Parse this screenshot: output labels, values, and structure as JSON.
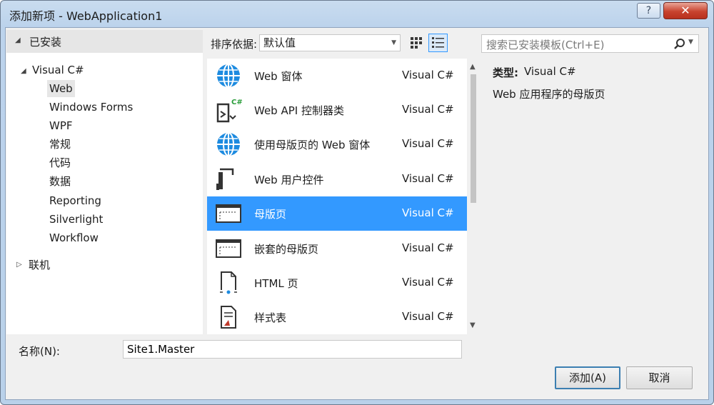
{
  "window": {
    "title": "添加新项 - WebApplication1",
    "help_label": "?",
    "close_label": "✕"
  },
  "left": {
    "installed": "已安装",
    "root": "Visual C#",
    "children": [
      "Web",
      "Windows Forms",
      "WPF",
      "常规",
      "代码",
      "数据",
      "Reporting",
      "Silverlight",
      "Workflow"
    ],
    "online": "联机"
  },
  "toolbar": {
    "sort_label": "排序依据:",
    "sort_value": "默认值"
  },
  "templates": [
    {
      "name": "Web 窗体",
      "lang": "Visual C#",
      "icon": "globe-icon"
    },
    {
      "name": "Web API 控制器类",
      "lang": "Visual C#",
      "icon": "api-controller-icon"
    },
    {
      "name": "使用母版页的 Web 窗体",
      "lang": "Visual C#",
      "icon": "globe-icon"
    },
    {
      "name": "Web 用户控件",
      "lang": "Visual C#",
      "icon": "user-control-icon"
    },
    {
      "name": "母版页",
      "lang": "Visual C#",
      "icon": "master-page-icon"
    },
    {
      "name": "嵌套的母版页",
      "lang": "Visual C#",
      "icon": "master-page-icon"
    },
    {
      "name": "HTML 页",
      "lang": "Visual C#",
      "icon": "html-page-icon"
    },
    {
      "name": "样式表",
      "lang": "Visual C#",
      "icon": "stylesheet-icon"
    }
  ],
  "selected_template": "母版页",
  "details": {
    "search_placeholder": "搜索已安装模板(Ctrl+E)",
    "type_label": "类型:",
    "type_value": "Visual C#",
    "description": "Web 应用程序的母版页"
  },
  "bottom": {
    "name_label": "名称(N):",
    "name_value": "Site1.Master",
    "add_button": "添加(A)",
    "cancel_button": "取消"
  },
  "colors": {
    "selection": "#3399ff",
    "title_bar": "#bcd3ec",
    "close_button": "#c8432f"
  }
}
